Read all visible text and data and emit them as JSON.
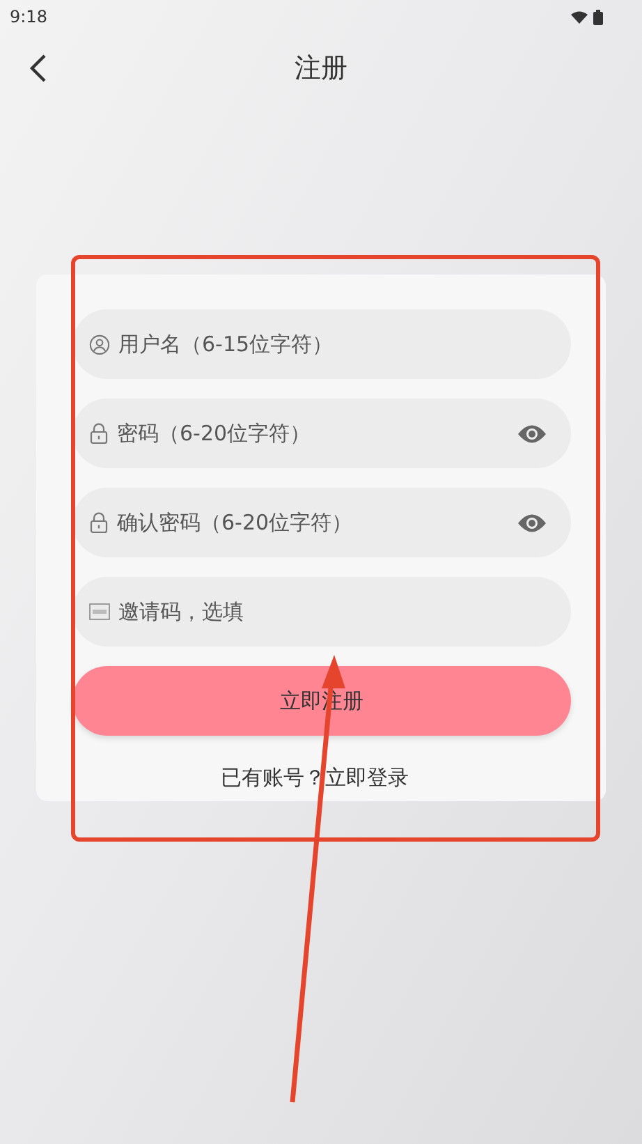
{
  "status_bar": {
    "time": "9:18"
  },
  "header": {
    "title": "注册"
  },
  "fields": [
    {
      "kind": "username",
      "placeholder": "用户名（6-15位字符）"
    },
    {
      "kind": "password",
      "placeholder": "密码（6-20位字符）"
    },
    {
      "kind": "password",
      "placeholder": "确认密码（6-20位字符）"
    },
    {
      "kind": "invite",
      "placeholder": "邀请码，选填"
    }
  ],
  "submit_button": "立即注册",
  "login_link": "已有账号？立即登录"
}
